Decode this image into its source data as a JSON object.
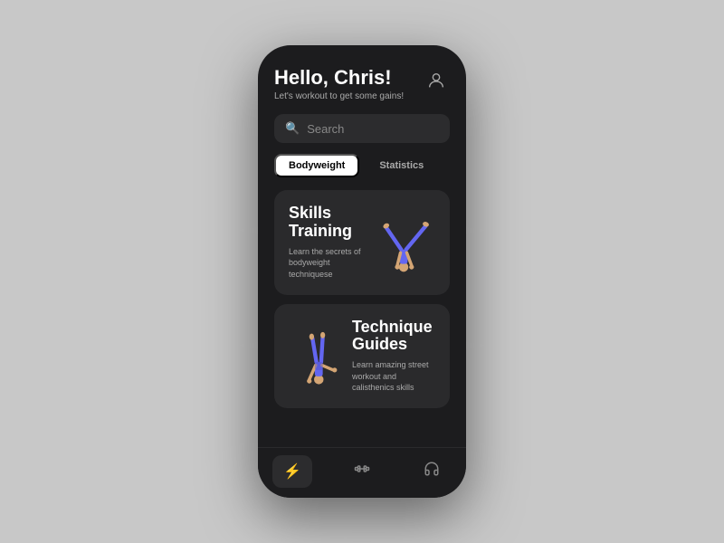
{
  "header": {
    "greeting": "Hello, Chris!",
    "subtitle": "Let's workout to get some gains!"
  },
  "search": {
    "placeholder": "Search"
  },
  "tabs": [
    {
      "label": "Bodyweight",
      "active": true
    },
    {
      "label": "Statistics",
      "active": false
    }
  ],
  "cards": [
    {
      "title": "Skills\nTraining",
      "description": "Learn the secrets of bodyweight techniquese",
      "figure": "handstand-cartwheel"
    },
    {
      "title": "Technique\nGuides",
      "description": "Learn amazing street workout and calisthenics skills",
      "figure": "one-arm-handstand"
    }
  ],
  "nav": [
    {
      "icon": "lightning",
      "active": true
    },
    {
      "icon": "dumbbell",
      "active": false
    },
    {
      "icon": "headphones",
      "active": false
    }
  ],
  "colors": {
    "accent": "#5b5fff",
    "background": "#1c1c1e",
    "card": "#2a2a2c",
    "text_primary": "#ffffff",
    "text_secondary": "#aaaaaa"
  }
}
